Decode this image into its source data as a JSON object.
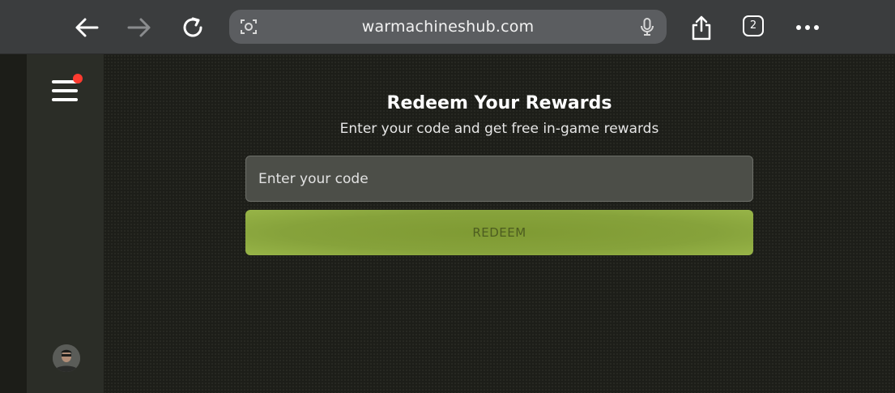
{
  "browser": {
    "url": "warmachineshub.com",
    "tab_count": "2",
    "icons": [
      "back-arrow-icon",
      "forward-arrow-icon",
      "reload-icon",
      "scan-icon",
      "microphone-icon",
      "share-icon",
      "tabs-icon",
      "more-icon"
    ]
  },
  "sidebar": {
    "menu_icon": "hamburger-icon",
    "notification_color": "#ff3b30",
    "avatar": "soldier-avatar"
  },
  "main": {
    "title": "Redeem Your Rewards",
    "subtitle": "Enter your code and get free in-game rewards",
    "code_input": {
      "value": "",
      "placeholder": "Enter your code"
    },
    "redeem_label": "REDEEM",
    "accent_color": "#86a23b"
  }
}
